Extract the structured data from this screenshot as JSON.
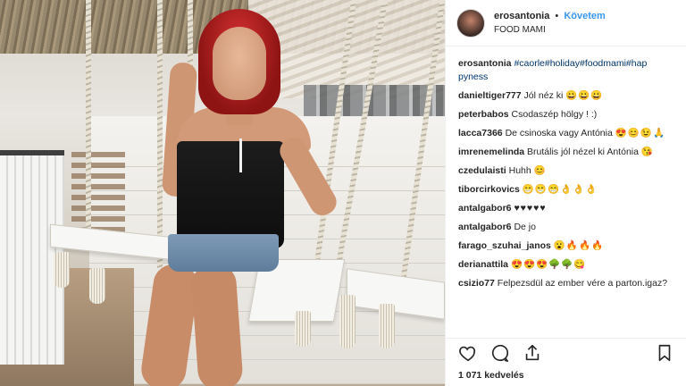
{
  "post": {
    "username": "erosantonia",
    "separator": "•",
    "follow_label": "Követem",
    "location": "FOOD MAMI",
    "caption_user": "erosantonia",
    "caption_tags": "#caorle#holiday#foodmami#hap pyness"
  },
  "comments": [
    {
      "user": "danieltiger777",
      "text": "Jól néz ki",
      "emoji": "😀😀😀"
    },
    {
      "user": "peterbabos",
      "text": "Csodaszép hölgy ! :)",
      "emoji": ""
    },
    {
      "user": "lacca7366",
      "text": "De csinoska vagy Antónia",
      "emoji": "😍😊😉🙏"
    },
    {
      "user": "imrenemelinda",
      "text": "Brutális jól nézel ki Antónia",
      "emoji": "😘"
    },
    {
      "user": "czedulaisti",
      "text": "Huhh",
      "emoji": "😊"
    },
    {
      "user": "tiborcirkovics",
      "text": "",
      "emoji": "😁😁😁👌👌👌"
    },
    {
      "user": "antalgabor6",
      "text": "",
      "emoji": "♥♥♥♥♥"
    },
    {
      "user": "antalgabor6",
      "text": "De jo",
      "emoji": ""
    },
    {
      "user": "farago_szuhai_janos",
      "text": "",
      "emoji": "😮🔥🔥🔥"
    },
    {
      "user": "derianattila",
      "text": "",
      "emoji": "😍😍😍🌳🌳😋"
    },
    {
      "user": "csizio77",
      "text": "Felpezsdül az ember vére a parton.igaz?",
      "emoji": ""
    }
  ],
  "actions": {
    "like_icon": "heart-icon",
    "comment_icon": "comment-icon",
    "share_icon": "share-icon",
    "save_icon": "bookmark-icon"
  },
  "likes_text": "1 071 kedvelés",
  "colors": {
    "link": "#3897f0",
    "tag": "#003569",
    "text": "#262626"
  }
}
